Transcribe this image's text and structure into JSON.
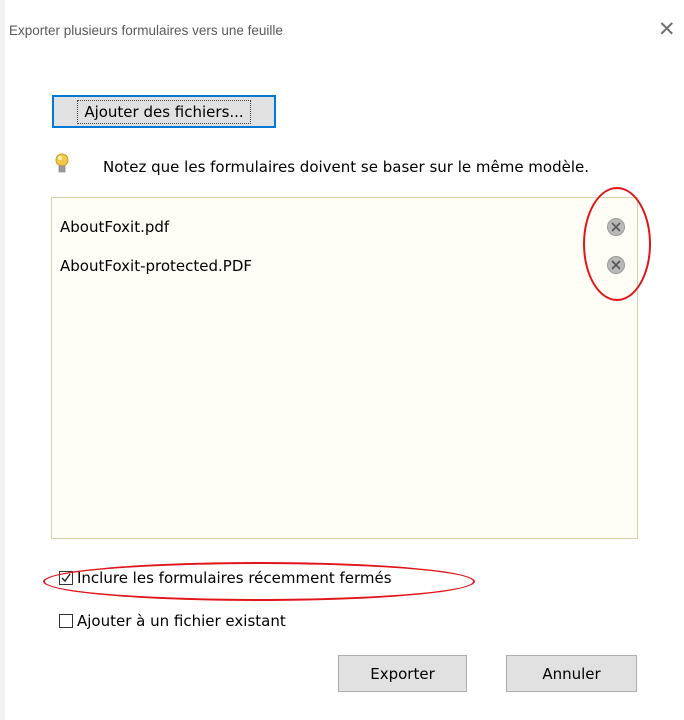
{
  "window": {
    "title": "Exporter plusieurs formulaires vers une feuille",
    "close_glyph": "✕"
  },
  "toolbar": {
    "add_files_label": "Ajouter des fichiers..."
  },
  "note": {
    "icon": "lightbulb-icon",
    "text": "Notez que les formulaires doivent se baser sur le même modèle."
  },
  "file_list": {
    "items": [
      {
        "name": "AboutFoxit.pdf",
        "remove_icon": "remove-circle-icon"
      },
      {
        "name": "AboutFoxit-protected.PDF",
        "remove_icon": "remove-circle-icon"
      }
    ]
  },
  "options": {
    "include_recent": {
      "label": "Inclure les formulaires récemment fermés",
      "checked": true
    },
    "append_existing": {
      "label": "Ajouter à un fichier existant",
      "checked": false
    }
  },
  "actions": {
    "export_label": "Exporter",
    "cancel_label": "Annuler"
  },
  "colors": {
    "annotation_red": "#e0151a",
    "focus_blue": "#0078d7",
    "list_background": "#fffef6"
  }
}
